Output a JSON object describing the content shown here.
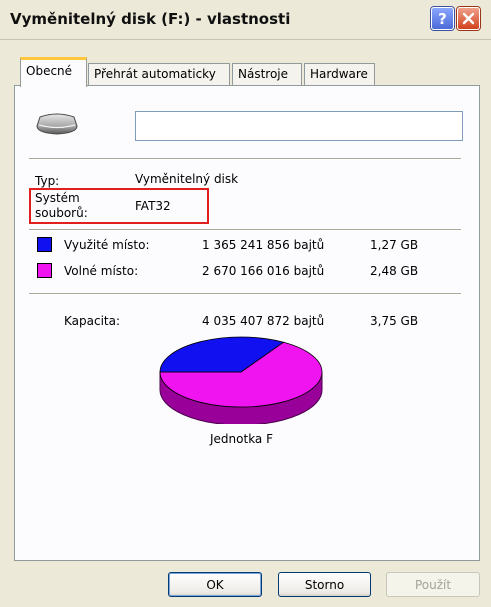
{
  "window": {
    "title": "Vyměnitelný disk (F:) - vlastnosti"
  },
  "titlebar": {
    "help_glyph": "?",
    "close_glyph": "✕"
  },
  "tabs": [
    {
      "label": "Obecné",
      "active": true
    },
    {
      "label": "Přehrát automaticky",
      "active": false
    },
    {
      "label": "Nástroje",
      "active": false
    },
    {
      "label": "Hardware",
      "active": false
    }
  ],
  "general": {
    "name_value": "",
    "type_label": "Typ:",
    "type_value": "Vyměnitelný disk",
    "fs_label_line1": "Systém",
    "fs_label_line2": "souborů:",
    "fs_value": "FAT32"
  },
  "space": {
    "used_label": "Využité místo:",
    "used_bytes": "1 365 241 856 bajtů",
    "used_size": "1,27 GB",
    "used_color": "#1010f0",
    "free_label": "Volné místo:",
    "free_bytes": "2 670 166 016 bajtů",
    "free_size": "2,48 GB",
    "free_color": "#f015f0",
    "capacity_label": "Kapacita:",
    "capacity_bytes": "4 035 407 872 bajtů",
    "capacity_size": "3,75 GB"
  },
  "chart": {
    "caption": "Jednotka F",
    "used_fraction": 0.338
  },
  "buttons": {
    "ok": "OK",
    "cancel": "Storno",
    "apply": "Použít"
  },
  "icons": {
    "drive": "removable-drive-icon",
    "help": "help-icon",
    "close": "close-icon"
  }
}
